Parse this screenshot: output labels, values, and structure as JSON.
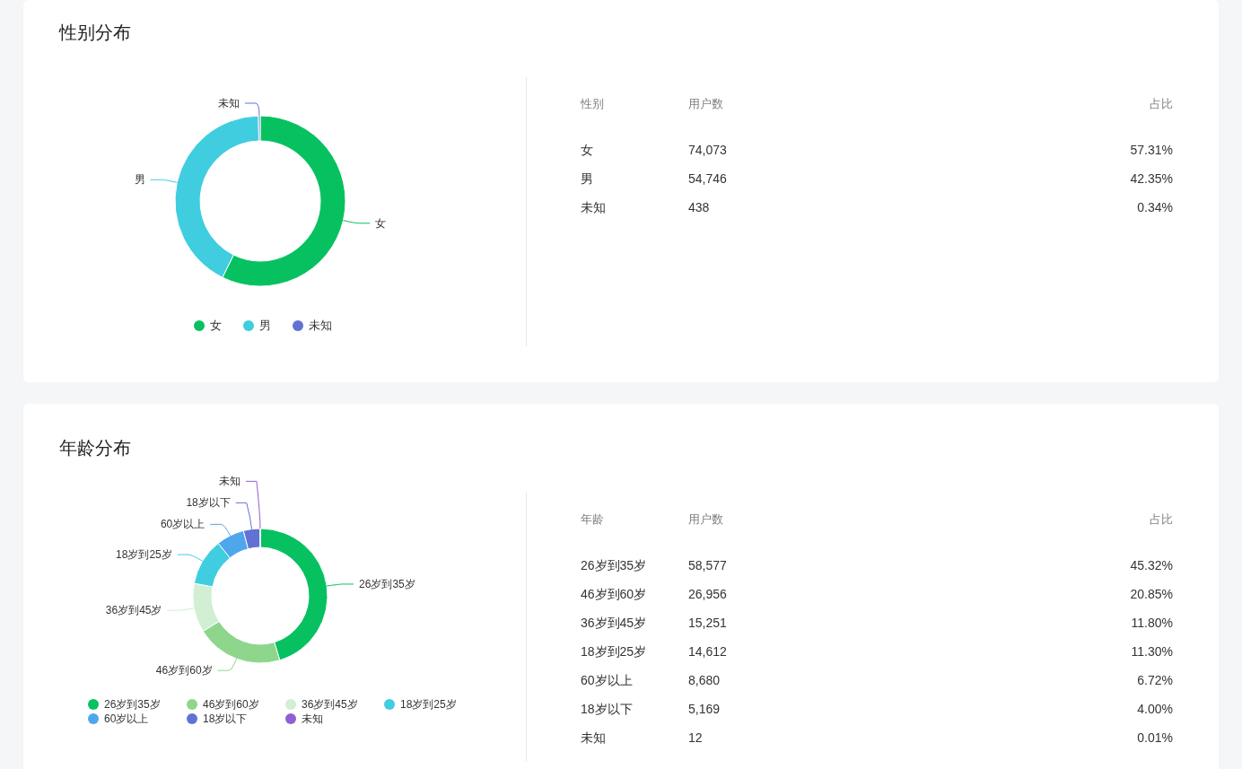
{
  "sections": [
    {
      "title": "性别分布",
      "chart_data": {
        "type": "donut",
        "categories": [
          "女",
          "男",
          "未知"
        ],
        "values": [
          57.31,
          42.35,
          0.34
        ]
      },
      "legend": [
        {
          "label": "女",
          "color": "#07c160"
        },
        {
          "label": "男",
          "color": "#40cde0"
        },
        {
          "label": "未知",
          "color": "#6172d4"
        }
      ],
      "table": {
        "columns": [
          "性别",
          "用户数",
          "占比"
        ],
        "rows": [
          [
            "女",
            "74,073",
            "57.31%"
          ],
          [
            "男",
            "54,746",
            "42.35%"
          ],
          [
            "未知",
            "438",
            "0.34%"
          ]
        ]
      }
    },
    {
      "title": "年龄分布",
      "chart_data": {
        "type": "donut",
        "categories": [
          "26岁到35岁",
          "46岁到60岁",
          "36岁到45岁",
          "18岁到25岁",
          "60岁以上",
          "18岁以下",
          "未知"
        ],
        "values": [
          45.32,
          20.85,
          11.8,
          11.3,
          6.72,
          4.0,
          0.01
        ]
      },
      "legend": [
        {
          "label": "26岁到35岁",
          "color": "#07c160"
        },
        {
          "label": "46岁到60岁",
          "color": "#8dd68c"
        },
        {
          "label": "36岁到45岁",
          "color": "#d0efd3"
        },
        {
          "label": "18岁到25岁",
          "color": "#40cde0"
        },
        {
          "label": "60岁以上",
          "color": "#4ea6ec"
        },
        {
          "label": "18岁以下",
          "color": "#6172d4"
        },
        {
          "label": "未知",
          "color": "#9160d0"
        }
      ],
      "table": {
        "columns": [
          "年龄",
          "用户数",
          "占比"
        ],
        "rows": [
          [
            "26岁到35岁",
            "58,577",
            "45.32%"
          ],
          [
            "46岁到60岁",
            "26,956",
            "20.85%"
          ],
          [
            "36岁到45岁",
            "15,251",
            "11.80%"
          ],
          [
            "18岁到25岁",
            "14,612",
            "11.30%"
          ],
          [
            "60岁以上",
            "8,680",
            "6.72%"
          ],
          [
            "18岁以下",
            "5,169",
            "4.00%"
          ],
          [
            "未知",
            "12",
            "0.01%"
          ]
        ]
      }
    }
  ]
}
